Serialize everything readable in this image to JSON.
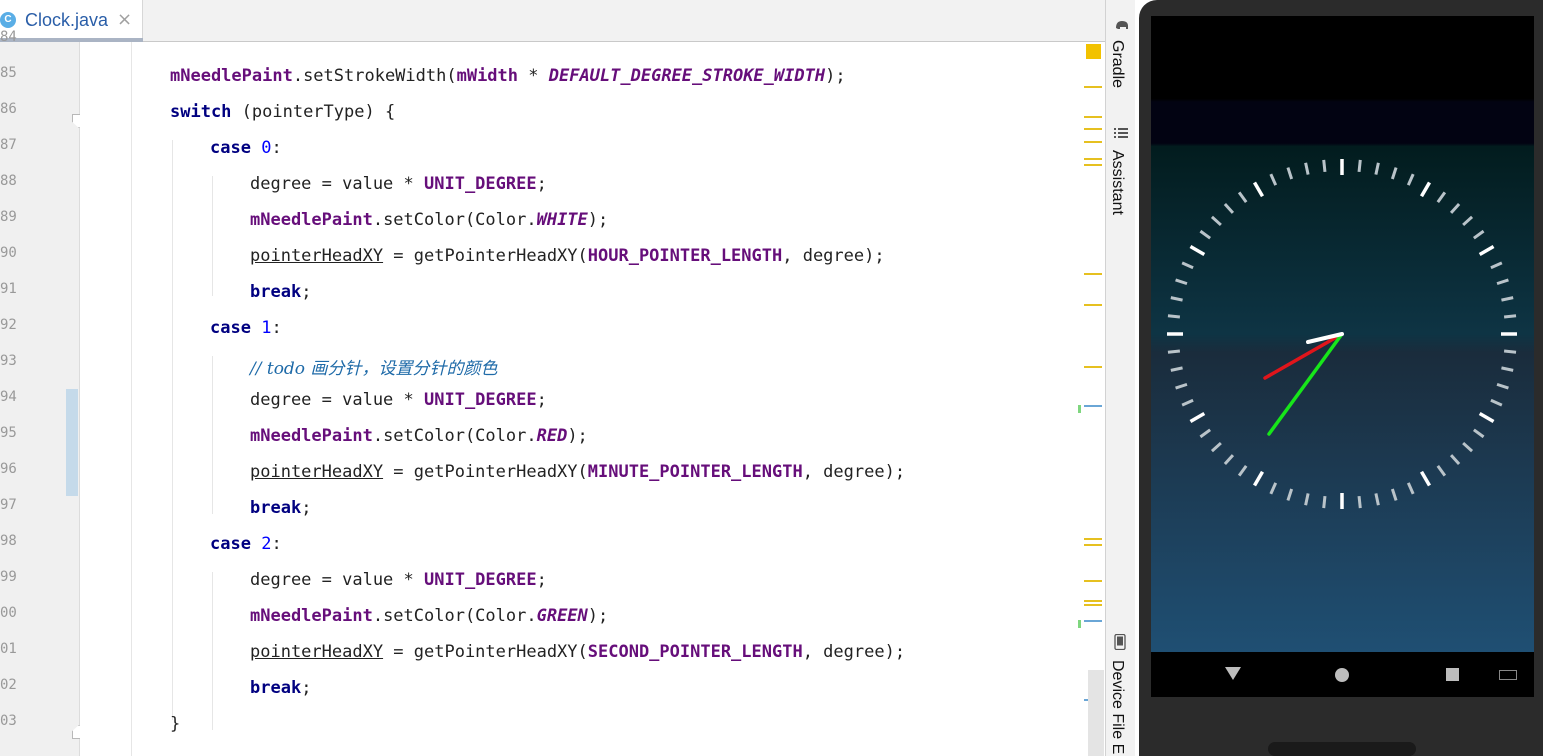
{
  "tab": {
    "icon_letter": "C",
    "title": "Clock.java",
    "close": "×"
  },
  "line_numbers": [
    "84",
    "85",
    "86",
    "87",
    "88",
    "89",
    "90",
    "91",
    "92",
    "93",
    "94",
    "95",
    "96",
    "97",
    "98",
    "99",
    "00",
    "01",
    "02",
    "03"
  ],
  "code": {
    "l85": {
      "a": "mNeedlePaint",
      "b": ".setStrokeWidth(",
      "c": "mWidth",
      "d": " * ",
      "e": "DEFAULT_DEGREE_STROKE_WIDTH",
      "f": ");"
    },
    "l86": {
      "kw": "switch",
      "rest": " (pointerType) {"
    },
    "l87": {
      "kw": "case",
      "sp": " ",
      "num": "0",
      "rest": ":"
    },
    "l88": {
      "a": "degree = value * ",
      "b": "UNIT_DEGREE",
      "c": ";"
    },
    "l89": {
      "a": "mNeedlePaint",
      "b": ".setColor(Color.",
      "c": "WHITE",
      "d": ");"
    },
    "l90": {
      "a": "pointerHeadXY",
      "b": " = getPointerHeadXY(",
      "c": "HOUR_POINTER_LENGTH",
      "d": ", degree);"
    },
    "l91": {
      "kw": "break",
      "rest": ";"
    },
    "l92": {
      "kw": "case",
      "sp": " ",
      "num": "1",
      "rest": ":"
    },
    "l93": {
      "comment": "// todo 画分针，设置分针的颜色"
    },
    "l94": {
      "a": "degree = value * ",
      "b": "UNIT_DEGREE",
      "c": ";"
    },
    "l95": {
      "a": "mNeedlePaint",
      "b": ".setColor(Color.",
      "c": "RED",
      "d": ");"
    },
    "l96": {
      "a": "pointerHeadXY",
      "b": " = getPointerHeadXY(",
      "c": "MINUTE_POINTER_LENGTH",
      "d": ", degree);"
    },
    "l97": {
      "kw": "break",
      "rest": ";"
    },
    "l98": {
      "kw": "case",
      "sp": " ",
      "num": "2",
      "rest": ":"
    },
    "l99": {
      "a": "degree = value * ",
      "b": "UNIT_DEGREE",
      "c": ";"
    },
    "l100": {
      "a": "mNeedlePaint",
      "b": ".setColor(Color.",
      "c": "GREEN",
      "d": ");"
    },
    "l101": {
      "a": "pointerHeadXY",
      "b": " = getPointerHeadXY(",
      "c": "SECOND_POINTER_LENGTH",
      "d": ", degree);"
    },
    "l102": {
      "kw": "break",
      "rest": ";"
    },
    "l103": {
      "rest": "}"
    }
  },
  "tool_windows": {
    "gradle": "Gradle",
    "assistant": "Assistant",
    "device_file": "Device File E"
  },
  "clock": {
    "hour_color": "#ffffff",
    "minute_color": "#e0151b",
    "second_color": "#17e61a"
  },
  "colors": {
    "keyword": "#000080",
    "field": "#660e7a",
    "number": "#0000ff",
    "comment": "#1e6aa8",
    "warning": "#f2c200"
  }
}
